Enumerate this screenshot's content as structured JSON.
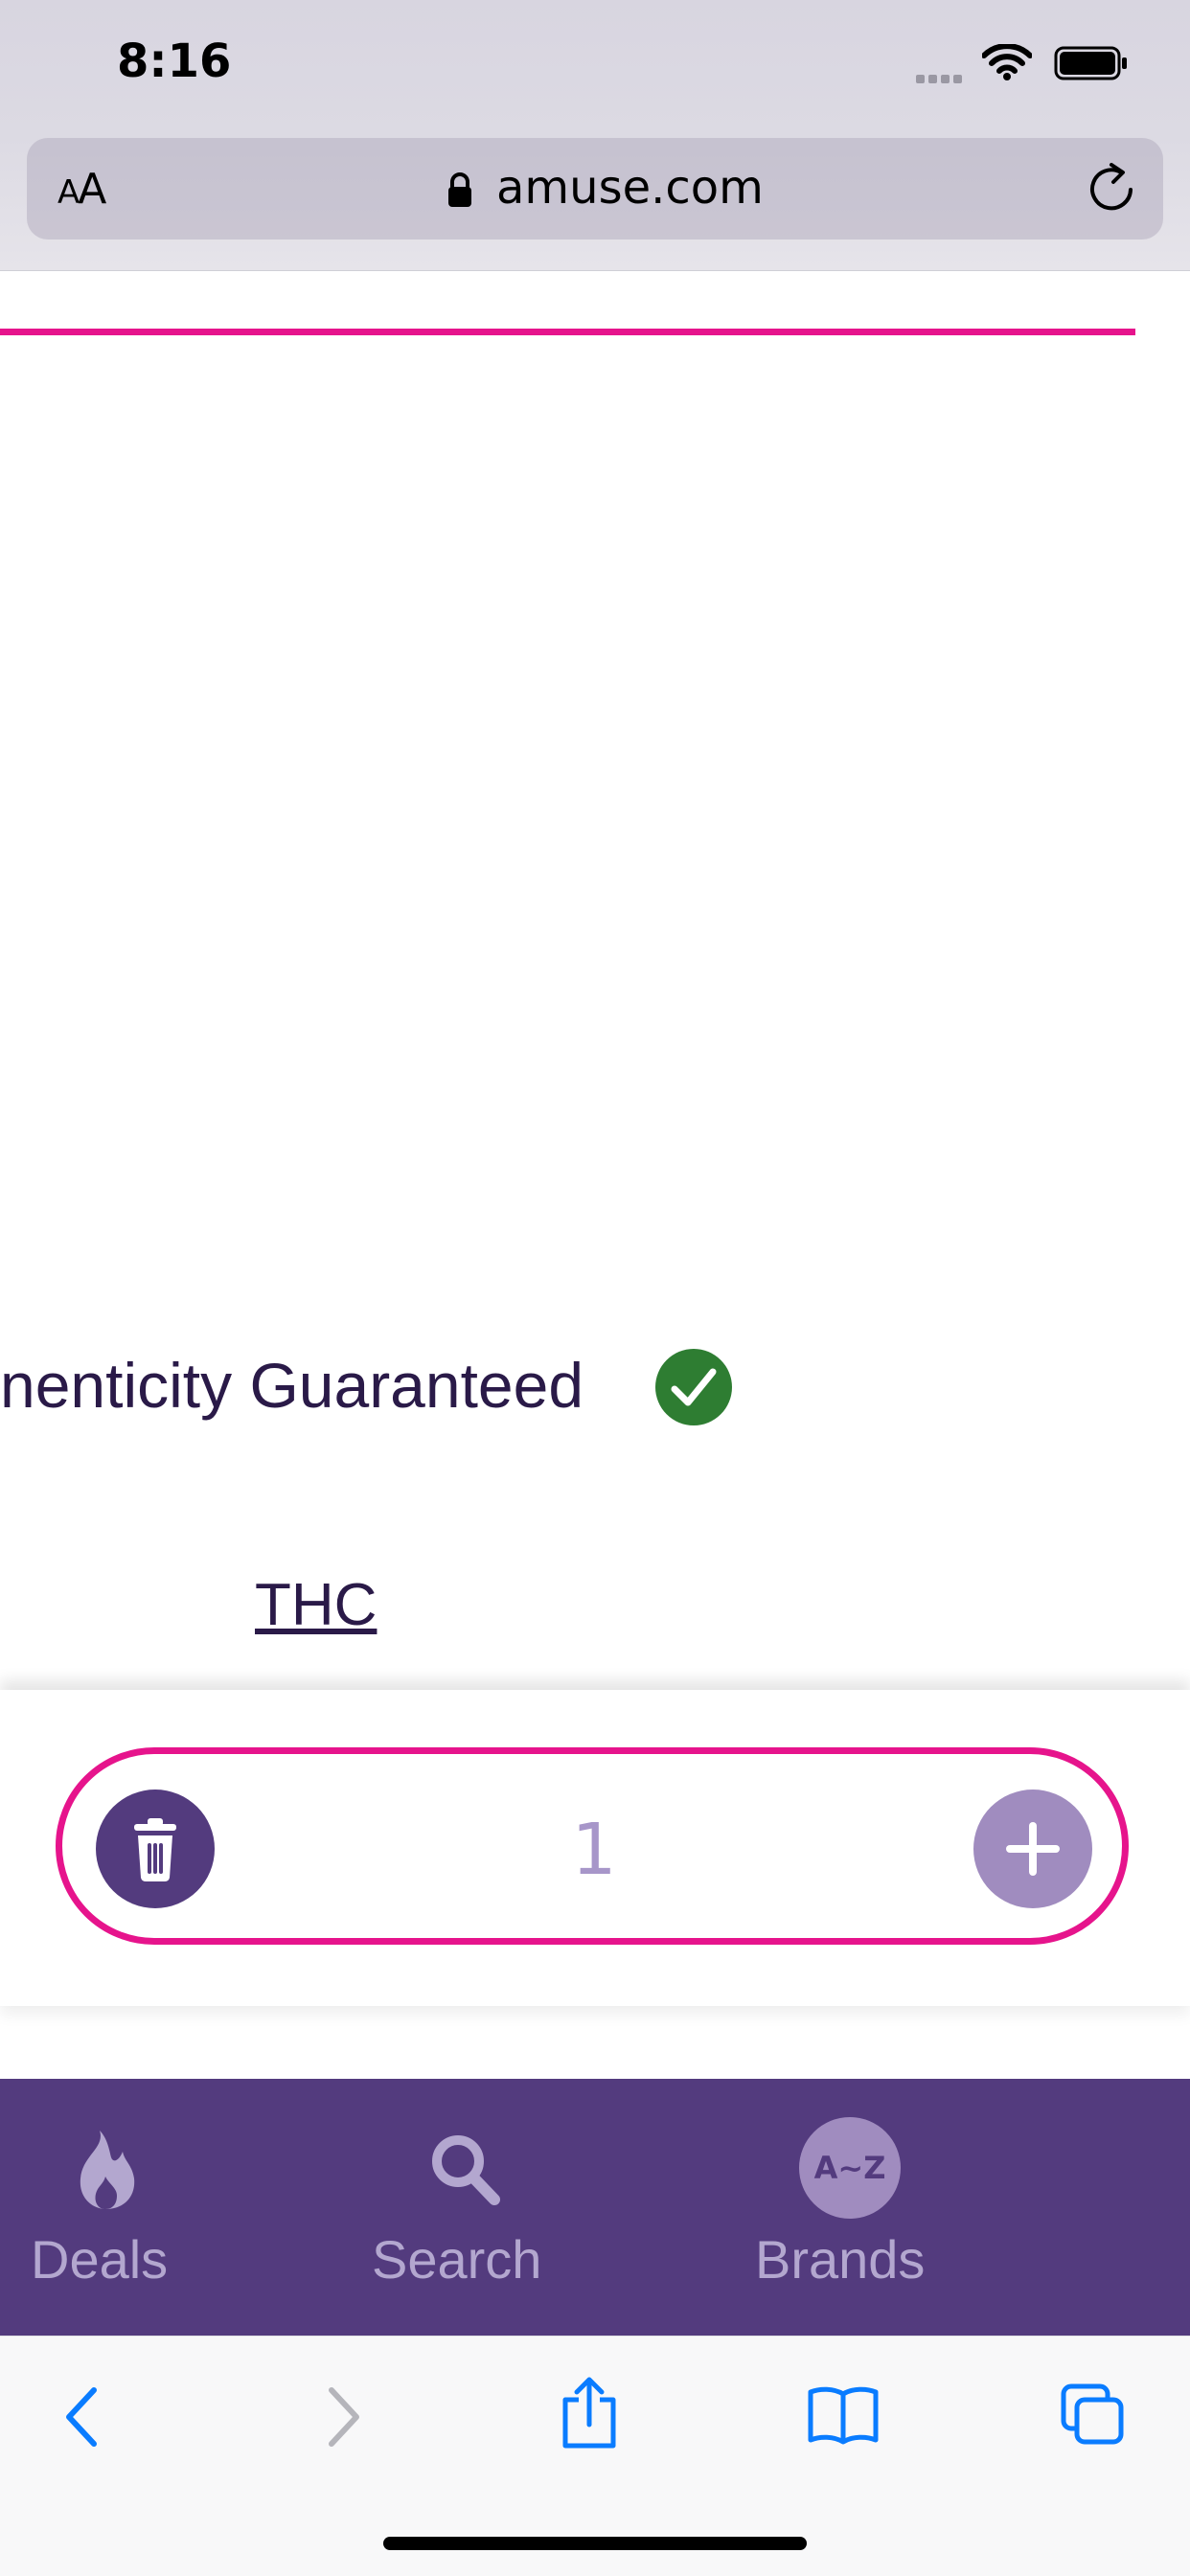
{
  "status_bar": {
    "time": "8:16"
  },
  "browser": {
    "aa_label_small": "A",
    "aa_label_large": "A",
    "url": "amuse.com"
  },
  "content": {
    "authenticity_text": "nenticity Guaranteed",
    "thc_link": "THC"
  },
  "cart": {
    "quantity": "1"
  },
  "app_nav": {
    "items": [
      {
        "label": "Deals",
        "icon": "flame-icon"
      },
      {
        "label": "Search",
        "icon": "search-icon"
      },
      {
        "label": "Brands",
        "icon": "a-to-z-icon",
        "badge": "A~Z"
      }
    ]
  },
  "colors": {
    "accent_pink": "#e6148c",
    "brand_purple": "#533b7e",
    "light_purple": "#a08cbf",
    "ios_blue": "#0a7cff",
    "verified_green": "#2e7d32"
  }
}
